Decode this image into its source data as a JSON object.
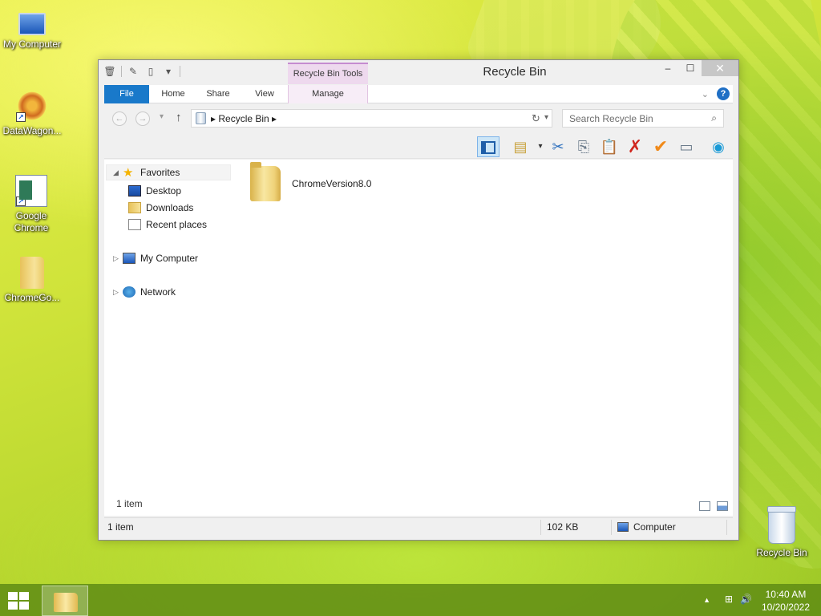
{
  "desktop": {
    "icons": [
      {
        "label": "My Computer",
        "icon": "computer-icon"
      },
      {
        "label": "DataWagon...",
        "icon": "datawagon-icon"
      },
      {
        "label": "Google Chrome",
        "icon": "chrome-shortcut-icon"
      },
      {
        "label": "ChromeGo...",
        "icon": "folder-icon"
      }
    ],
    "recycle_bin_label": "Recycle Bin"
  },
  "window": {
    "title": "Recycle Bin",
    "contextual_tab_group": "Recycle Bin Tools",
    "ribbon_tabs": [
      "File",
      "Home",
      "Share",
      "View",
      "Manage"
    ],
    "caption_buttons": {
      "minimize": "‒",
      "maximize": "☐",
      "close": "✕"
    },
    "address": {
      "breadcrumb": "Recycle Bin"
    },
    "search": {
      "placeholder": "Search Recycle Bin"
    },
    "nav_pane": {
      "favorites": "Favorites",
      "items": [
        "Desktop",
        "Downloads",
        "Recent places"
      ],
      "my_computer": "My Computer",
      "network": "Network"
    },
    "files": [
      {
        "name": "ChromeVersion8.0",
        "type": "folder"
      }
    ],
    "content_item_count": "1 item",
    "status_bar": {
      "items": "1 item",
      "size": "102 KB",
      "location": "Computer"
    }
  },
  "taskbar": {
    "time": "10:40 AM",
    "date": "10/20/2022"
  },
  "colors": {
    "file_tab": "#1979ca",
    "contextual_tab": "#eed9ee",
    "taskbar": "#5f8c14"
  }
}
